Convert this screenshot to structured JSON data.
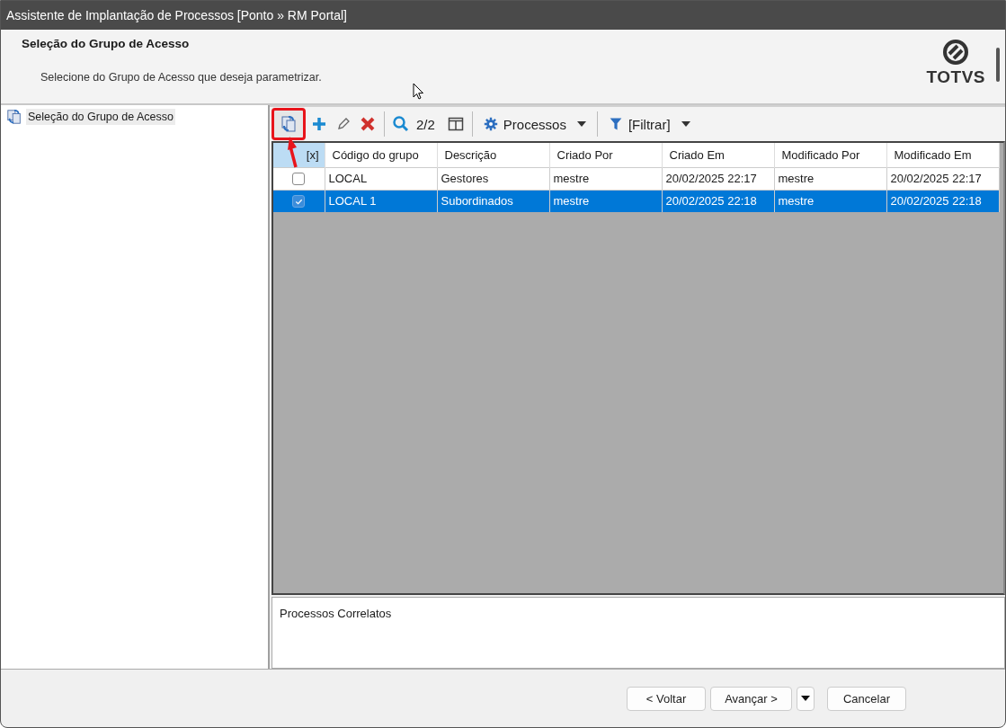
{
  "window": {
    "title": "Assistente de Implantação de Processos [Ponto » RM Portal]"
  },
  "header": {
    "title": "Seleção do Grupo de Acesso",
    "subtitle": "Selecione do Grupo de Acesso que deseja parametrizar.",
    "logo": "TOTVS"
  },
  "steps": [
    {
      "label": "Seleção do Grupo de Acesso",
      "selected": true
    }
  ],
  "toolbar": {
    "record_count": "2/2",
    "processes_menu": "Processos",
    "filter_menu": "[Filtrar]"
  },
  "table": {
    "check_header": "[x]",
    "columns": [
      "Código do grupo",
      "Descrição",
      "Criado Por",
      "Criado Em",
      "Modificado Por",
      "Modificado Em"
    ],
    "rows": [
      {
        "checked": false,
        "selected": false,
        "cells": [
          "LOCAL",
          "Gestores",
          "mestre",
          "20/02/2025 22:17",
          "mestre",
          "20/02/2025 22:17"
        ]
      },
      {
        "checked": true,
        "selected": true,
        "cells": [
          "LOCAL 1",
          "Subordinados",
          "mestre",
          "20/02/2025 22:18",
          "mestre",
          "20/02/2025 22:18"
        ]
      }
    ]
  },
  "details": {
    "title": "Processos Correlatos"
  },
  "buttons": {
    "back": "< Voltar",
    "next": "Avançar >",
    "cancel": "Cancelar"
  }
}
